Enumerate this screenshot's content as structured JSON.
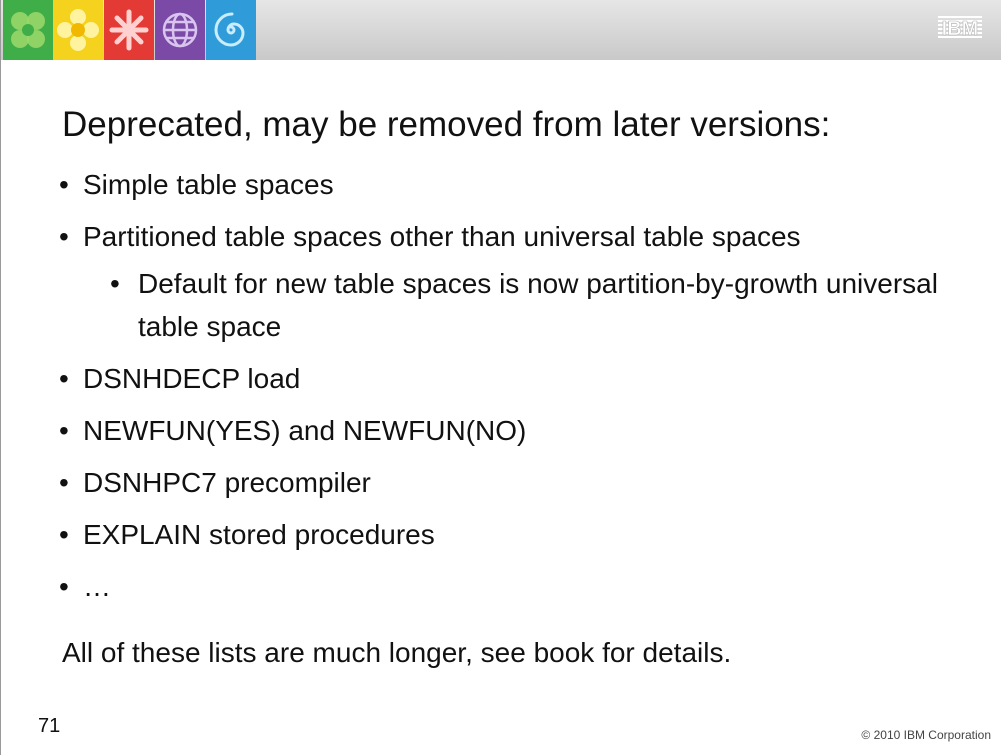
{
  "header": {
    "icons": [
      "clover-icon",
      "flower-icon",
      "asterisk-icon",
      "globe-icon",
      "spiral-icon"
    ],
    "brand_logo": "IBM",
    "colors": {
      "green": "#3fae49",
      "yellow": "#f5d21e",
      "red": "#e43a35",
      "purple": "#7b4aa6",
      "blue": "#2f9bd8"
    }
  },
  "slide": {
    "title": "Deprecated, may be removed from later versions:",
    "bullets": [
      "Simple table spaces",
      "Partitioned table spaces other than universal table spaces",
      "DSNHDECP load",
      "NEWFUN(YES) and NEWFUN(NO)",
      "DSNHPC7 precompiler",
      "EXPLAIN stored procedures",
      "…"
    ],
    "sub_bullet": "Default for new table spaces is now partition-by-growth universal table space",
    "bullet_char": "•",
    "closing": "All of these lists are much longer, see book for details."
  },
  "footer": {
    "page_number": "71",
    "copyright": "© 2010 IBM Corporation"
  }
}
